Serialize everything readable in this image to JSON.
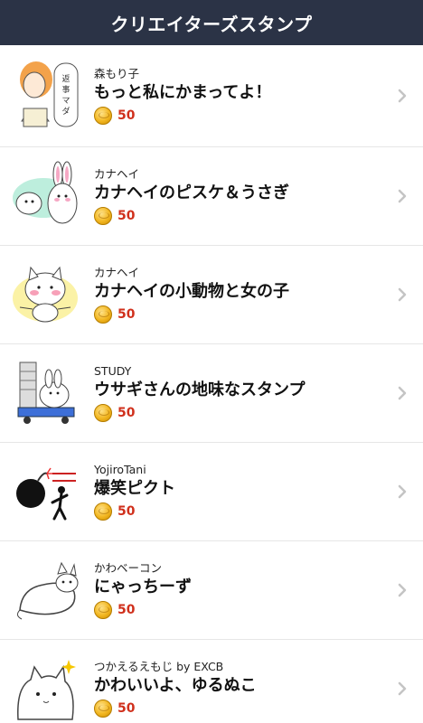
{
  "header": {
    "title": "クリエイターズスタンプ"
  },
  "items": [
    {
      "author": "森もり子",
      "title": "もっと私にかまってよ！",
      "price": "50",
      "icon": "girl-sticker-icon"
    },
    {
      "author": "カナヘイ",
      "title": "カナヘイのピスケ＆うさぎ",
      "price": "50",
      "icon": "bird-rabbit-sticker-icon"
    },
    {
      "author": "カナヘイ",
      "title": "カナヘイの小動物と女の子",
      "price": "50",
      "icon": "cat-sticker-icon"
    },
    {
      "author": "STUDY",
      "title": "ウサギさんの地味なスタンプ",
      "price": "50",
      "icon": "rabbit-cart-sticker-icon"
    },
    {
      "author": "YojiroTani",
      "title": "爆笑ピクト",
      "price": "50",
      "icon": "bomb-pict-sticker-icon"
    },
    {
      "author": "かわベーコン",
      "title": "にゃっちーず",
      "price": "50",
      "icon": "lying-cat-sticker-icon"
    },
    {
      "author": "つかえるえもじ by EXCB",
      "title": "かわいいよ、ゆるぬこ",
      "price": "50",
      "icon": "fluffy-cat-sticker-icon"
    }
  ],
  "colors": {
    "header_bg": "#2b3346",
    "price": "#d0301c",
    "coin": "#f2b620"
  }
}
